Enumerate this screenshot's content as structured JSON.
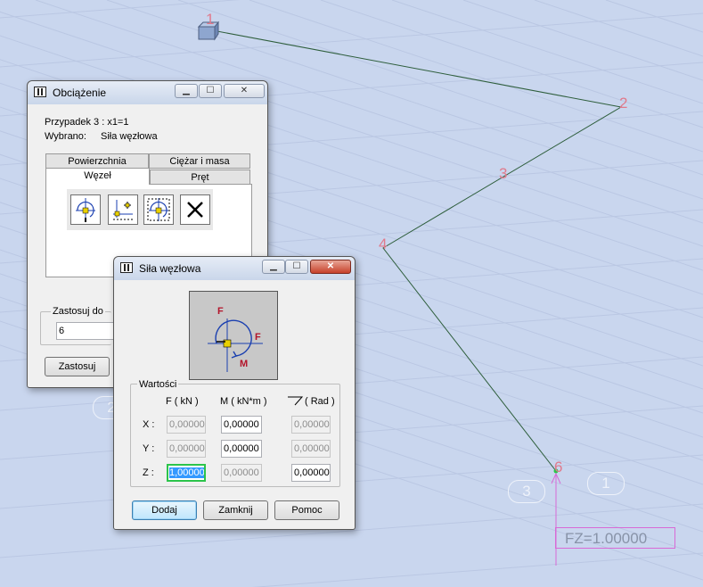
{
  "viewport": {
    "node_labels": [
      "1",
      "2",
      "3",
      "4",
      "6"
    ],
    "ghost_badges": [
      "3",
      "1",
      "2"
    ],
    "load_label": "FZ=1.00000",
    "colors": {
      "member": "#2e5e3c",
      "node_label": "#e07a8c",
      "load": "#d86ad6",
      "grid": "#b8c6e3"
    }
  },
  "load_dialog": {
    "title": "Obciążenie",
    "case_line": "Przypadek 3 : x1=1",
    "selected_label": "Wybrano:",
    "selected_value": "Siła węzłowa",
    "tabs": [
      "Powierzchnia",
      "Ciężar i masa",
      "Węzeł",
      "Pręt"
    ],
    "active_tab": "Węzeł",
    "tool_icons": [
      "nodal-force-icon",
      "support-displacement-icon",
      "nodal-mass-icon",
      "delete-load-icon"
    ],
    "apply_group_label": "Zastosuj do",
    "apply_value": "6",
    "apply_button": "Zastosuj",
    "window_buttons": [
      "minimize-icon",
      "maximize-icon",
      "close-icon"
    ]
  },
  "force_dialog": {
    "title": "Siła węzłowa",
    "preview": {
      "f_top": "F",
      "f_right": "F",
      "m": "M"
    },
    "group_label": "Wartości",
    "col_f": "F  ( kN )",
    "col_m": "M  ( kN*m )",
    "col_rad": "( Rad )",
    "rows": [
      {
        "label": "X :",
        "f": "0,00000",
        "m": "0,00000",
        "rad": "0,00000"
      },
      {
        "label": "Y :",
        "f": "0,00000",
        "m": "0,00000",
        "rad": "0,00000"
      },
      {
        "label": "Z :",
        "f": "1,00000",
        "m": "0,00000",
        "rad": "0,00000"
      }
    ],
    "add_button": "Dodaj",
    "close_button": "Zamknij",
    "help_button": "Pomoc"
  }
}
